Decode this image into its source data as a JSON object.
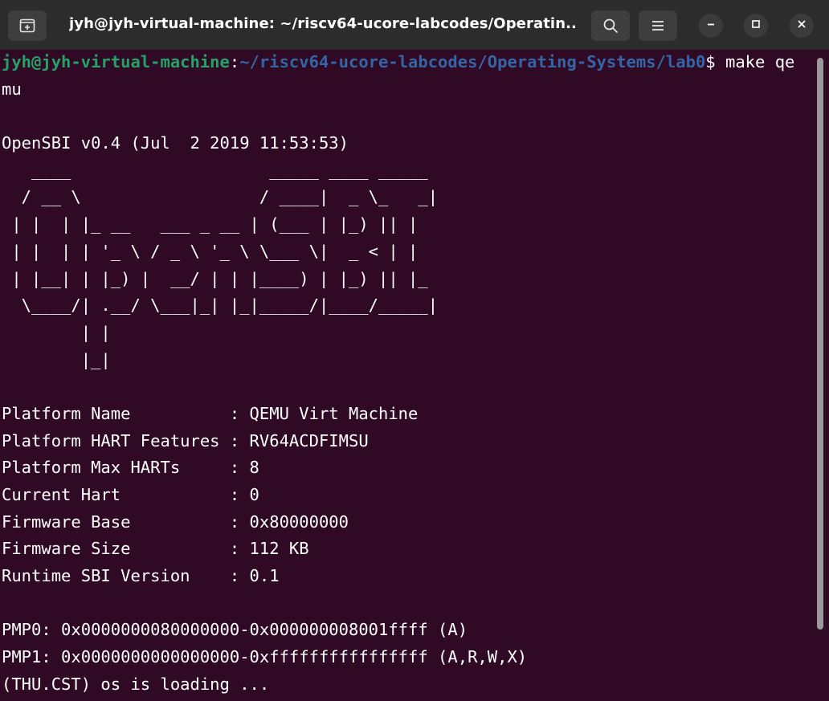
{
  "window": {
    "title": "jyh@jyh-virtual-machine: ~/riscv64-ucore-labcodes/Operatin..."
  },
  "icons": {
    "new_tab": "new-tab-icon",
    "search": "search-icon",
    "menu": "hamburger-menu-icon",
    "minimize": "minimize-icon",
    "maximize": "maximize-icon",
    "close": "close-icon"
  },
  "colors": {
    "background": "#300a24",
    "prompt_user": "#26a269",
    "prompt_path": "#3465a4",
    "text": "#ffffff"
  },
  "terminal": {
    "prompt_user": "jyh@jyh-virtual-machine",
    "prompt_sep": ":",
    "prompt_path": "~/riscv64-ucore-labcodes/Operating-Systems/lab0",
    "prompt_end": "$ make qe",
    "command_wrap": "mu",
    "blank1": "",
    "opensbi_version": "OpenSBI v0.4 (Jul  2 2019 11:53:53)",
    "logo": [
      "   ____                    _____ ____ _____",
      "  / __ \\                  / ____|  _ \\_   _|",
      " | |  | |_ __   ___ _ __ | (___ | |_) || |",
      " | |  | | '_ \\ / _ \\ '_ \\ \\___ \\|  _ < | |",
      " | |__| | |_) |  __/ | | |____) | |_) || |_",
      "  \\____/| .__/ \\___|_| |_|_____/|____/_____|",
      "        | |",
      "        |_|"
    ],
    "blank2": "",
    "info": [
      "Platform Name          : QEMU Virt Machine",
      "Platform HART Features : RV64ACDFIMSU",
      "Platform Max HARTs     : 8",
      "Current Hart           : 0",
      "Firmware Base          : 0x80000000",
      "Firmware Size          : 112 KB",
      "Runtime SBI Version    : 0.1"
    ],
    "blank3": "",
    "pmp": [
      "PMP0: 0x0000000080000000-0x000000008001ffff (A)",
      "PMP1: 0x0000000000000000-0xffffffffffffffff (A,R,W,X)"
    ],
    "loading": "(THU.CST) os is loading ..."
  }
}
